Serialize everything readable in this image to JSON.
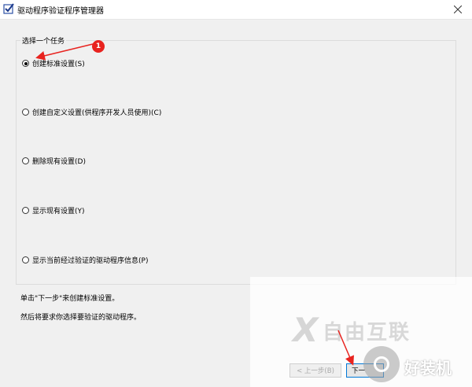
{
  "window": {
    "title": "驱动程序验证程序管理器"
  },
  "group": {
    "legend": "选择一个任务"
  },
  "options": [
    {
      "label": "创建标准设置(S)",
      "checked": true
    },
    {
      "label": "创建自定义设置(供程序开发人员使用)(C)",
      "checked": false
    },
    {
      "label": "删除现有设置(D)",
      "checked": false
    },
    {
      "label": "显示现有设置(Y)",
      "checked": false
    },
    {
      "label": "显示当前经过验证的驱动程序信息(P)",
      "checked": false
    }
  ],
  "hints": {
    "line1": "单击\"下一步\"来创建标准设置。",
    "line2": "然后将要求你选择要验证的驱动程序。"
  },
  "buttons": {
    "back_label": "< 上一步(B)",
    "next_label": "下一"
  },
  "annotation": {
    "badge": "1",
    "color": "#e8231f"
  },
  "watermark": {
    "logo_letter": "X",
    "brand_text": "自由互联",
    "brand_text2": "好装机"
  },
  "colors": {
    "accent": "#0078d7",
    "annotation": "#e8231f"
  }
}
